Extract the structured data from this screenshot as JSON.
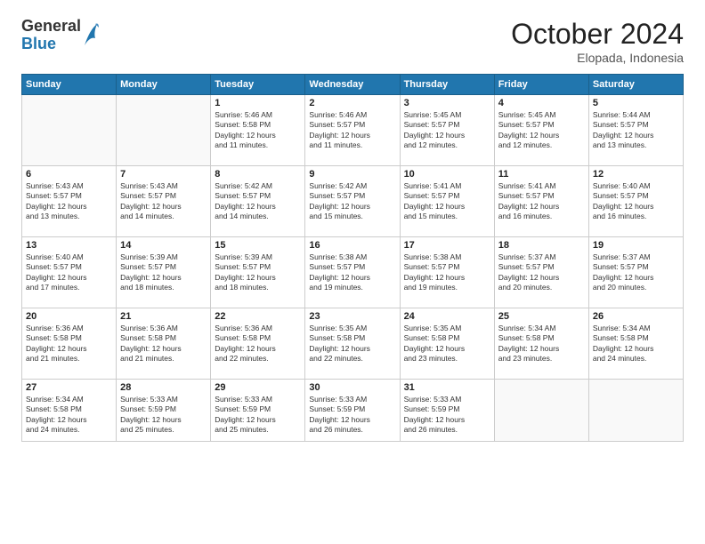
{
  "header": {
    "logo": {
      "general": "General",
      "blue": "Blue"
    },
    "title": "October 2024",
    "location": "Elopada, Indonesia"
  },
  "weekdays": [
    "Sunday",
    "Monday",
    "Tuesday",
    "Wednesday",
    "Thursday",
    "Friday",
    "Saturday"
  ],
  "weeks": [
    [
      {
        "day": "",
        "content": ""
      },
      {
        "day": "",
        "content": ""
      },
      {
        "day": "1",
        "content": "Sunrise: 5:46 AM\nSunset: 5:58 PM\nDaylight: 12 hours\nand 11 minutes."
      },
      {
        "day": "2",
        "content": "Sunrise: 5:46 AM\nSunset: 5:57 PM\nDaylight: 12 hours\nand 11 minutes."
      },
      {
        "day": "3",
        "content": "Sunrise: 5:45 AM\nSunset: 5:57 PM\nDaylight: 12 hours\nand 12 minutes."
      },
      {
        "day": "4",
        "content": "Sunrise: 5:45 AM\nSunset: 5:57 PM\nDaylight: 12 hours\nand 12 minutes."
      },
      {
        "day": "5",
        "content": "Sunrise: 5:44 AM\nSunset: 5:57 PM\nDaylight: 12 hours\nand 13 minutes."
      }
    ],
    [
      {
        "day": "6",
        "content": "Sunrise: 5:43 AM\nSunset: 5:57 PM\nDaylight: 12 hours\nand 13 minutes."
      },
      {
        "day": "7",
        "content": "Sunrise: 5:43 AM\nSunset: 5:57 PM\nDaylight: 12 hours\nand 14 minutes."
      },
      {
        "day": "8",
        "content": "Sunrise: 5:42 AM\nSunset: 5:57 PM\nDaylight: 12 hours\nand 14 minutes."
      },
      {
        "day": "9",
        "content": "Sunrise: 5:42 AM\nSunset: 5:57 PM\nDaylight: 12 hours\nand 15 minutes."
      },
      {
        "day": "10",
        "content": "Sunrise: 5:41 AM\nSunset: 5:57 PM\nDaylight: 12 hours\nand 15 minutes."
      },
      {
        "day": "11",
        "content": "Sunrise: 5:41 AM\nSunset: 5:57 PM\nDaylight: 12 hours\nand 16 minutes."
      },
      {
        "day": "12",
        "content": "Sunrise: 5:40 AM\nSunset: 5:57 PM\nDaylight: 12 hours\nand 16 minutes."
      }
    ],
    [
      {
        "day": "13",
        "content": "Sunrise: 5:40 AM\nSunset: 5:57 PM\nDaylight: 12 hours\nand 17 minutes."
      },
      {
        "day": "14",
        "content": "Sunrise: 5:39 AM\nSunset: 5:57 PM\nDaylight: 12 hours\nand 18 minutes."
      },
      {
        "day": "15",
        "content": "Sunrise: 5:39 AM\nSunset: 5:57 PM\nDaylight: 12 hours\nand 18 minutes."
      },
      {
        "day": "16",
        "content": "Sunrise: 5:38 AM\nSunset: 5:57 PM\nDaylight: 12 hours\nand 19 minutes."
      },
      {
        "day": "17",
        "content": "Sunrise: 5:38 AM\nSunset: 5:57 PM\nDaylight: 12 hours\nand 19 minutes."
      },
      {
        "day": "18",
        "content": "Sunrise: 5:37 AM\nSunset: 5:57 PM\nDaylight: 12 hours\nand 20 minutes."
      },
      {
        "day": "19",
        "content": "Sunrise: 5:37 AM\nSunset: 5:57 PM\nDaylight: 12 hours\nand 20 minutes."
      }
    ],
    [
      {
        "day": "20",
        "content": "Sunrise: 5:36 AM\nSunset: 5:58 PM\nDaylight: 12 hours\nand 21 minutes."
      },
      {
        "day": "21",
        "content": "Sunrise: 5:36 AM\nSunset: 5:58 PM\nDaylight: 12 hours\nand 21 minutes."
      },
      {
        "day": "22",
        "content": "Sunrise: 5:36 AM\nSunset: 5:58 PM\nDaylight: 12 hours\nand 22 minutes."
      },
      {
        "day": "23",
        "content": "Sunrise: 5:35 AM\nSunset: 5:58 PM\nDaylight: 12 hours\nand 22 minutes."
      },
      {
        "day": "24",
        "content": "Sunrise: 5:35 AM\nSunset: 5:58 PM\nDaylight: 12 hours\nand 23 minutes."
      },
      {
        "day": "25",
        "content": "Sunrise: 5:34 AM\nSunset: 5:58 PM\nDaylight: 12 hours\nand 23 minutes."
      },
      {
        "day": "26",
        "content": "Sunrise: 5:34 AM\nSunset: 5:58 PM\nDaylight: 12 hours\nand 24 minutes."
      }
    ],
    [
      {
        "day": "27",
        "content": "Sunrise: 5:34 AM\nSunset: 5:58 PM\nDaylight: 12 hours\nand 24 minutes."
      },
      {
        "day": "28",
        "content": "Sunrise: 5:33 AM\nSunset: 5:59 PM\nDaylight: 12 hours\nand 25 minutes."
      },
      {
        "day": "29",
        "content": "Sunrise: 5:33 AM\nSunset: 5:59 PM\nDaylight: 12 hours\nand 25 minutes."
      },
      {
        "day": "30",
        "content": "Sunrise: 5:33 AM\nSunset: 5:59 PM\nDaylight: 12 hours\nand 26 minutes."
      },
      {
        "day": "31",
        "content": "Sunrise: 5:33 AM\nSunset: 5:59 PM\nDaylight: 12 hours\nand 26 minutes."
      },
      {
        "day": "",
        "content": ""
      },
      {
        "day": "",
        "content": ""
      }
    ]
  ]
}
